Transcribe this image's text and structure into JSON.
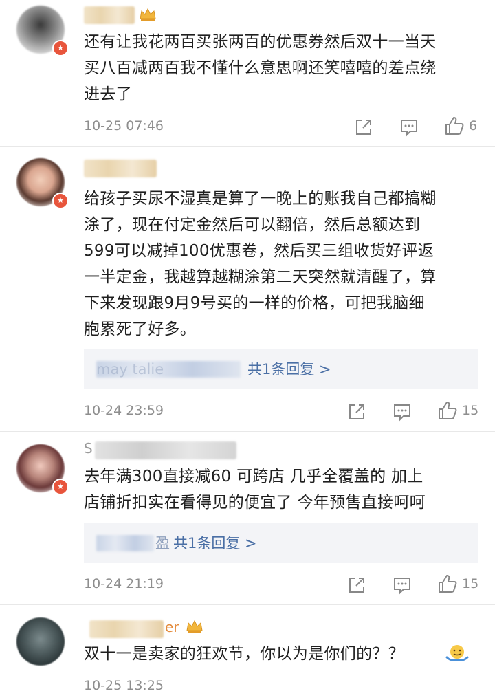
{
  "comments": [
    {
      "username": "",
      "lines": [
        "还有让我花两百买张两百的优惠券然后双十一当天",
        "买八百减两百我不懂什么意思啊还笑嘻嘻的差点绕",
        "进去了"
      ],
      "time": "10-25 07:46",
      "likes": "6"
    },
    {
      "username": "",
      "lines": [
        "给孩子买尿不湿真是算了一晚上的账我自己都搞糊",
        "涂了，现在付定金然后可以翻倍，然后总额达到",
        "599可以减掉100优惠卷，然后买三组收货好评返",
        "一半定金，我越算越糊涂第二天突然就清醒了，算",
        "下来发现跟9月9号买的一样的价格，可把我脑细",
        "胞累死了好多。"
      ],
      "reply_name": "may talie",
      "reply_count": "共1条回复 >",
      "time": "10-24 23:59",
      "likes": "15"
    },
    {
      "username": "S",
      "lines": [
        "去年满300直接减60 可跨店 几乎全覆盖的 加上",
        "店铺折扣实在看得见的便宜了 今年预售直接呵呵"
      ],
      "reply_name": "盈",
      "reply_count": "共1条回复 >",
      "time": "10-24 21:19",
      "likes": "15"
    },
    {
      "username": "er",
      "lines": [
        "双十一是卖家的狂欢节，你以为是你们的？？"
      ],
      "time": "10-25 13:25"
    }
  ],
  "colors": {
    "reply_link": "#4a6fa5",
    "meta": "#8e8e8e",
    "vip_badge": "#e8553c",
    "username_gold": "#e48b3c"
  },
  "icons": [
    "share-icon",
    "comment-icon",
    "thumbs-up-icon",
    "v-badge-icon",
    "crown-icon",
    "shrug-emoji-icon"
  ]
}
